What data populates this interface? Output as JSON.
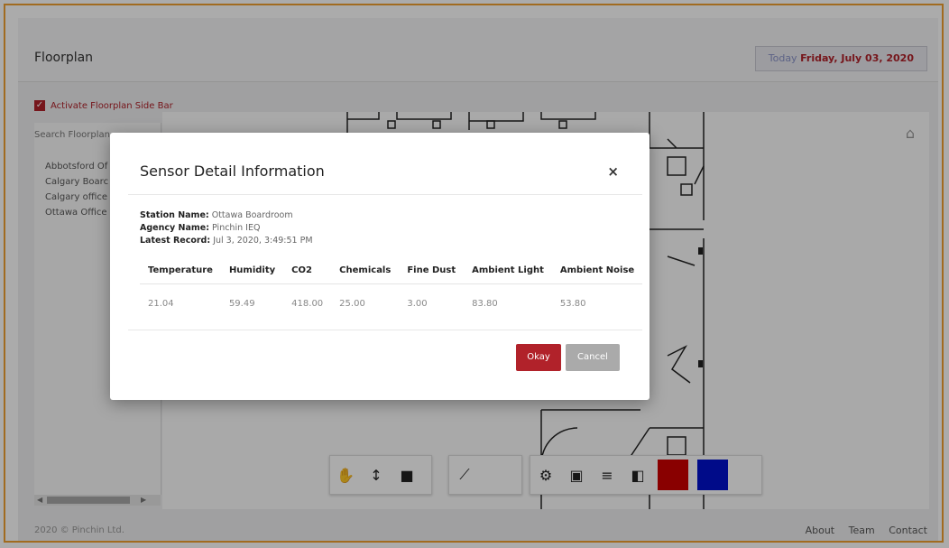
{
  "header": {
    "title": "Floorplan",
    "today_label": "Today",
    "today_date": "Friday, July 03, 2020"
  },
  "sidebar": {
    "activate_label": "Activate Floorplan Side Bar",
    "search_placeholder": "Search Floorplan",
    "floorplans": [
      "Abbotsford Of",
      "Calgary Boarc",
      "Calgary office",
      "Ottawa Office"
    ]
  },
  "toolbar": {
    "icons": [
      "hand-icon",
      "move-vertical-icon",
      "camera-icon",
      "ruler-icon",
      "gear-icon",
      "sensor-icon",
      "layers-icon",
      "contrast-icon"
    ],
    "swatch_colors": [
      "#cc0000",
      "#0011cc"
    ]
  },
  "modal": {
    "title": "Sensor Detail Information",
    "close": "×",
    "station_label": "Station Name:",
    "station_value": "Ottawa Boardroom",
    "agency_label": "Agency Name:",
    "agency_value": "Pinchin IEQ",
    "record_label": "Latest Record:",
    "record_value": "Jul 3, 2020, 3:49:51 PM",
    "columns": [
      "Temperature",
      "Humidity",
      "CO2",
      "Chemicals",
      "Fine Dust",
      "Ambient Light",
      "Ambient Noise"
    ],
    "values": [
      "21.04",
      "59.49",
      "418.00",
      "25.00",
      "3.00",
      "83.80",
      "53.80"
    ],
    "okay_label": "Okay",
    "cancel_label": "Cancel"
  },
  "footer": {
    "copyright": "2020 © Pinchin Ltd.",
    "links": [
      "About",
      "Team",
      "Contact"
    ]
  },
  "colors": {
    "accent": "#b1222a",
    "frame": "#f0a030"
  }
}
